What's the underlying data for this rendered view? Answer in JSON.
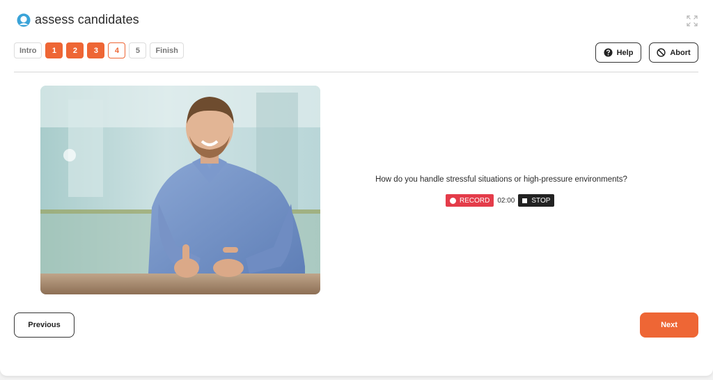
{
  "brand": {
    "name": "assess candidates",
    "accent": "#ee6635",
    "logo_color": "#3aa3d8"
  },
  "steps": [
    {
      "label": "Intro",
      "state": "pending"
    },
    {
      "label": "1",
      "state": "done"
    },
    {
      "label": "2",
      "state": "done"
    },
    {
      "label": "3",
      "state": "done"
    },
    {
      "label": "4",
      "state": "current"
    },
    {
      "label": "5",
      "state": "pending"
    },
    {
      "label": "Finish",
      "state": "pending"
    }
  ],
  "header": {
    "help_label": "Help",
    "abort_label": "Abort",
    "help_icon": "question-circle-icon",
    "abort_icon": "ban-icon",
    "expand_icon": "expand-icon"
  },
  "question": {
    "text": "How do you handle stressful situations or high-pressure environments?",
    "record_label": "RECORD",
    "timer": "02:00",
    "stop_label": "STOP",
    "record_color": "#e43c4a"
  },
  "footer": {
    "previous_label": "Previous",
    "next_label": "Next"
  }
}
